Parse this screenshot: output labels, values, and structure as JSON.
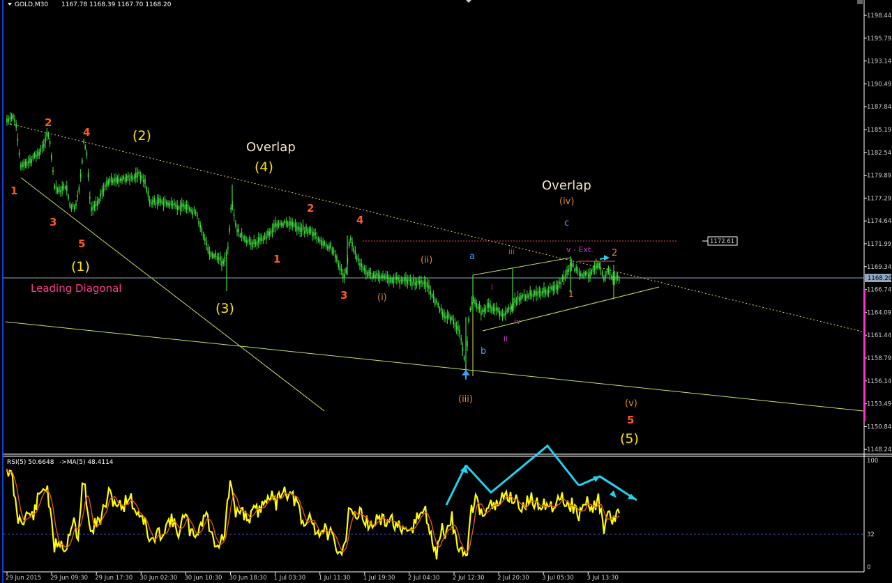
{
  "header": {
    "symbol": "GOLD,M30",
    "ohlc": "1167.78 1168.39 1167.70 1168.20",
    "rsi_label": "RSI(5) 50.6648",
    "ma_label": "->MA(5) 48.4114"
  },
  "colors": {
    "background": "#000000",
    "candle": "#3ddc3d",
    "rsi_line": "#ffff00",
    "ma_line": "#e05a10",
    "projection": "#22d3f0",
    "wave_red": "#ff5a1f",
    "wave_yellow": "#ffe600",
    "wave_cream": "#f5e6c8",
    "wave_orange": "#e08a2a",
    "wave_blue": "#3aa0ff",
    "wave_magenta": "#cc33cc",
    "leading_diag": "#ff3a8c",
    "trendline": "#c8e060",
    "bid_line": "#8fa8c0"
  },
  "price_axis": {
    "ticks": [
      "1198.44",
      "1195.79",
      "1193.14",
      "1190.49",
      "1187.84",
      "1185.19",
      "1182.54",
      "1179.89",
      "1177.29",
      "1174.64",
      "1171.99",
      "1169.34",
      "1166.74",
      "1164.09",
      "1161.44",
      "1158.79",
      "1156.14",
      "1153.49",
      "1150.84",
      "1148.24"
    ],
    "current": "1168.20",
    "marker_level": "1172.61"
  },
  "rsi_axis": {
    "ticks": [
      "100",
      "32",
      "0"
    ]
  },
  "time_axis": {
    "ticks": [
      "29 Jun 2015",
      "29 Jun 09:30",
      "29 Jun 17:30",
      "30 Jun 02:30",
      "30 Jun 10:30",
      "30 Jun 18:30",
      "1 Jul 03:30",
      "1 Jul 11:30",
      "1 Jul 19:30",
      "2 Jul 04:30",
      "2 Jul 12:30",
      "2 Jul 20:30",
      "3 Jul 05:30",
      "3 Jul 13:30"
    ]
  },
  "annotations": {
    "overlap_1": "Overlap",
    "overlap_2": "Overlap",
    "wave_2_big": "(2)",
    "wave_4_big": "(4)",
    "wave_1_big": "(1)",
    "wave_3_big": "(3)",
    "wave_5_big": "(5)",
    "leading_diagonal": "Leading Diagonal",
    "r1": "1",
    "r2": "2",
    "r3": "3",
    "r4": "4",
    "r5": "5",
    "m1": "1",
    "m2": "2",
    "m3": "3",
    "m4": "4",
    "end5": "5",
    "o_i": "(i)",
    "o_ii": "(ii)",
    "o_iii": "(iii)",
    "o_iv": "(iv)",
    "o_v": "(v)",
    "b_a": "a",
    "b_b": "b",
    "b_c": "c",
    "s_i": "i",
    "s_ii": "ii",
    "s_iii": "iii",
    "s_iv": "iv",
    "v_ext": "v - Ext.",
    "sub1": "1",
    "sub2": "2"
  }
}
